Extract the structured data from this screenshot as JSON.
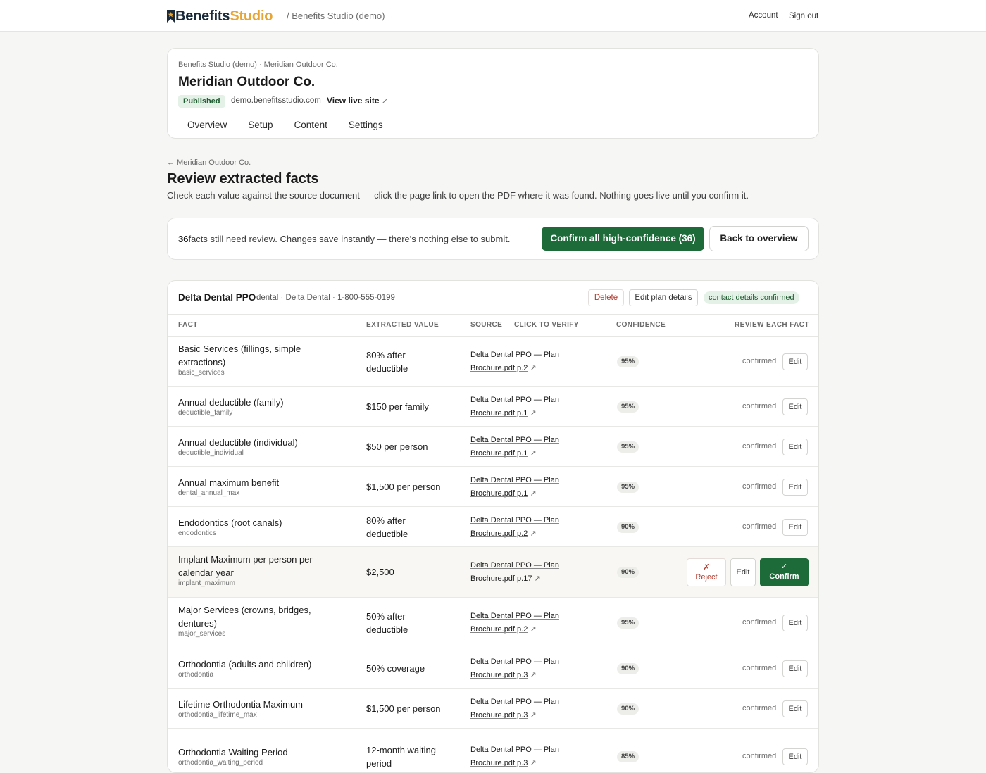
{
  "topbar": {
    "brand_part1": "Benefits",
    "brand_part2": "Studio",
    "crumb": "/ Benefits Studio (demo)",
    "account": "Account",
    "sign_out": "Sign out"
  },
  "site": {
    "crumb": "Benefits Studio (demo) · Meridian Outdoor Co.",
    "title": "Meridian Outdoor Co.",
    "status": "Published",
    "domain": "demo.benefitsstudio.com",
    "live_link": "View live site",
    "live_arrow": "↗",
    "tabs": [
      "Overview",
      "Setup",
      "Content",
      "Settings"
    ]
  },
  "review": {
    "back": "← Meridian Outdoor Co.",
    "title": "Review extracted facts",
    "subtitle": "Check each value against the source document — click the page link to open the PDF where it was found. Nothing goes live until you confirm it.",
    "count": "36",
    "status_text": "facts still need review. Changes save instantly — there's nothing else to submit.",
    "confirm_all": "Confirm all high-confidence (36)",
    "back_overview": "Back to overview"
  },
  "plan": {
    "name": "Delta Dental PPO",
    "meta": "dental · Delta Dental · 1-800-555-0199",
    "delete": "Delete",
    "edit_plan": "Edit plan details",
    "contact_badge": "contact details confirmed",
    "columns": [
      "FACT",
      "EXTRACTED VALUE",
      "SOURCE — CLICK TO VERIFY",
      "CONFIDENCE",
      "REVIEW EACH FACT"
    ],
    "status_confirmed": "confirmed",
    "edit_label": "Edit",
    "reject_label": "Reject",
    "reject_icon": "✗",
    "confirm_label": "Confirm",
    "confirm_icon": "✓",
    "ext_icon": "↗",
    "rows": [
      {
        "name_l1": "Basic Services (fillings, simple",
        "name_l2": "extractions)",
        "key": "basic_services",
        "val_l1": "80% after",
        "val_l2": "deductible",
        "src_l1": "Delta Dental PPO — Plan",
        "src_l2": "Brochure.pdf p.2",
        "conf": "95%",
        "status": "confirmed"
      },
      {
        "name_l1": "Annual deductible (family)",
        "name_l2": "",
        "key": "deductible_family",
        "val_l1": "$150 per family",
        "val_l2": "",
        "src_l1": "Delta Dental PPO — Plan",
        "src_l2": "Brochure.pdf p.1",
        "conf": "95%",
        "status": "confirmed"
      },
      {
        "name_l1": "Annual deductible (individual)",
        "name_l2": "",
        "key": "deductible_individual",
        "val_l1": "$50 per person",
        "val_l2": "",
        "src_l1": "Delta Dental PPO — Plan",
        "src_l2": "Brochure.pdf p.1",
        "conf": "95%",
        "status": "confirmed"
      },
      {
        "name_l1": "Annual maximum benefit",
        "name_l2": "",
        "key": "dental_annual_max",
        "val_l1": "$1,500 per person",
        "val_l2": "",
        "src_l1": "Delta Dental PPO — Plan",
        "src_l2": "Brochure.pdf p.1",
        "conf": "95%",
        "status": "confirmed"
      },
      {
        "name_l1": "Endodontics (root canals)",
        "name_l2": "",
        "key": "endodontics",
        "val_l1": "80% after",
        "val_l2": "deductible",
        "src_l1": "Delta Dental PPO — Plan",
        "src_l2": "Brochure.pdf p.2",
        "conf": "90%",
        "status": "confirmed"
      },
      {
        "name_l1": "Implant Maximum per person per",
        "name_l2": "calendar year",
        "key": "implant_maximum",
        "val_l1": "$2,500",
        "val_l2": "",
        "src_l1": "Delta Dental PPO — Plan",
        "src_l2": "Brochure.pdf p.17",
        "conf": "90%",
        "status": "pending"
      },
      {
        "name_l1": "Major Services (crowns, bridges,",
        "name_l2": "dentures)",
        "key": "major_services",
        "val_l1": "50% after",
        "val_l2": "deductible",
        "src_l1": "Delta Dental PPO — Plan",
        "src_l2": "Brochure.pdf p.2",
        "conf": "95%",
        "status": "confirmed"
      },
      {
        "name_l1": "Orthodontia (adults and children)",
        "name_l2": "",
        "key": "orthodontia",
        "val_l1": "50% coverage",
        "val_l2": "",
        "src_l1": "Delta Dental PPO — Plan",
        "src_l2": "Brochure.pdf p.3",
        "conf": "90%",
        "status": "confirmed"
      },
      {
        "name_l1": "Lifetime Orthodontia Maximum",
        "name_l2": "",
        "key": "orthodontia_lifetime_max",
        "val_l1": "$1,500 per person",
        "val_l2": "",
        "src_l1": "Delta Dental PPO — Plan",
        "src_l2": "Brochure.pdf p.3",
        "conf": "90%",
        "status": "confirmed"
      },
      {
        "name_l1": "Orthodontia Waiting Period",
        "name_l2": "",
        "key": "orthodontia_waiting_period",
        "val_l1": "12-month waiting",
        "val_l2": "period",
        "src_l1": "Delta Dental PPO — Plan",
        "src_l2": "Brochure.pdf p.3",
        "conf": "85%",
        "status": "confirmed"
      }
    ]
  }
}
